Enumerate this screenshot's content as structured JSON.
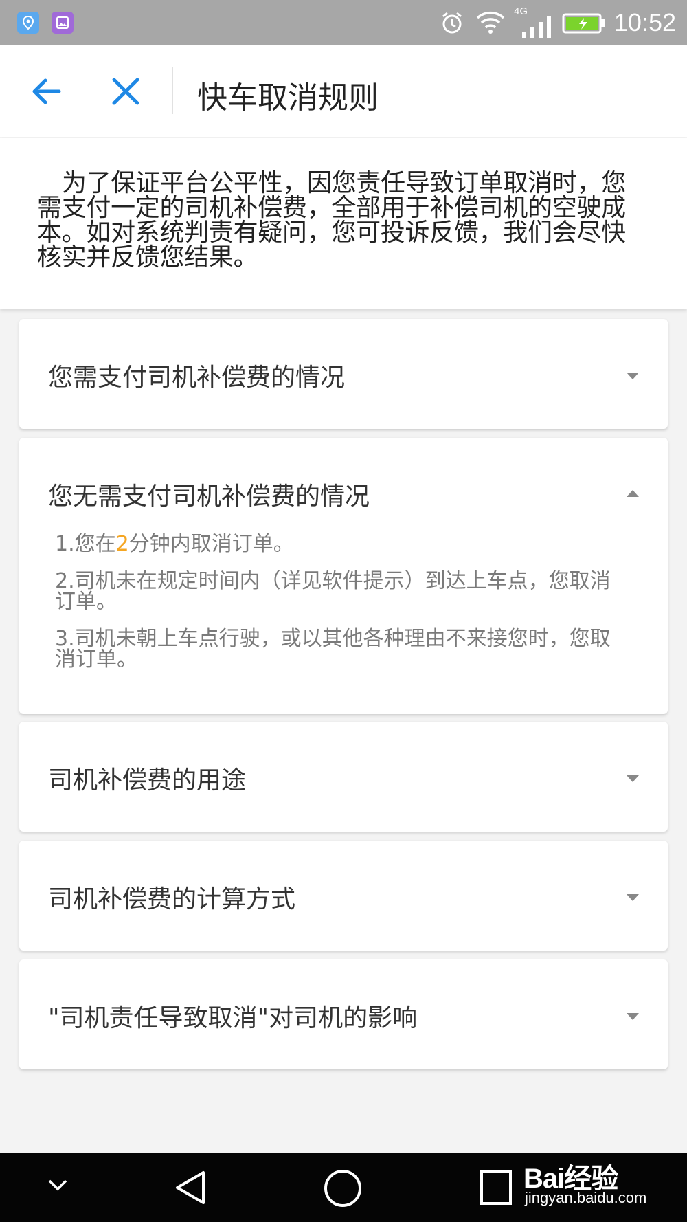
{
  "status_bar": {
    "time": "10:52",
    "network": "4G"
  },
  "header": {
    "title": "快车取消规则",
    "back_icon": "arrow-left-icon",
    "close_icon": "close-icon"
  },
  "intro": {
    "text": "为了保证平台公平性，因您责任导致订单取消时，您需支付一定的司机补偿费，全部用于补偿司机的空驶成本。如对系统判责有疑问，您可投诉反馈，我们会尽快核实并反馈您结果。"
  },
  "sections": [
    {
      "title": "您需支付司机补偿费的情况",
      "expanded": false
    },
    {
      "title": "您无需支付司机补偿费的情况",
      "expanded": true,
      "rule1_prefix": "1.您在",
      "rule1_number": "2",
      "rule1_suffix": "分钟内取消订单。",
      "rule2": "2.司机未在规定时间内（详见软件提示）到达上车点，您取消订单。",
      "rule3": "3.司机未朝上车点行驶，或以其他各种理由不来接您时，您取消订单。"
    },
    {
      "title": "司机补偿费的用途",
      "expanded": false
    },
    {
      "title": "司机补偿费的计算方式",
      "expanded": false
    },
    {
      "title": "\"司机责任导致取消\"对司机的影响",
      "expanded": false
    }
  ],
  "watermark": {
    "brand": "Bai经验",
    "url": "jingyan.baidu.com"
  },
  "colors": {
    "accent_blue": "#1e88e5",
    "highlight_orange": "#f5a623",
    "status_bar": "#a7a7a7",
    "nav_bar": "#050505"
  }
}
